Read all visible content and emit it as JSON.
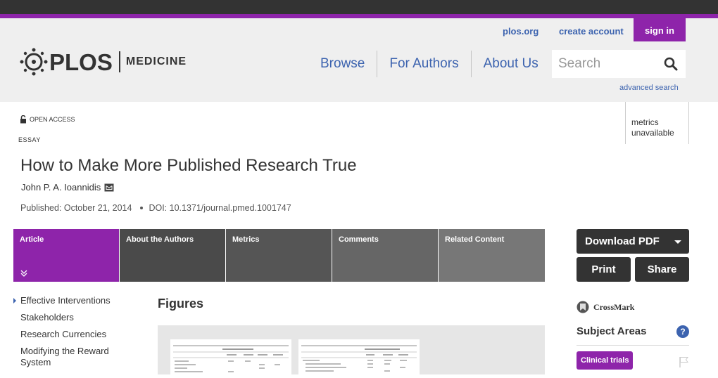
{
  "header": {
    "util_links": [
      "plos.org",
      "create account"
    ],
    "signin_label": "sign in",
    "logo_text": "PLOS",
    "journal_name": "MEDICINE",
    "nav": [
      "Browse",
      "For Authors",
      "About Us"
    ],
    "search_placeholder": "Search",
    "advanced_search": "advanced search"
  },
  "metrics": {
    "text_line1": "metrics",
    "text_line2": "unavailable"
  },
  "article": {
    "open_access": "OPEN ACCESS",
    "type": "ESSAY",
    "title": "How to Make More Published Research True",
    "author": "John P. A. Ioannidis",
    "published": "Published: October 21, 2014",
    "doi": "DOI: 10.1371/journal.pmed.1001747"
  },
  "tabs": [
    "Article",
    "About the Authors",
    "Metrics",
    "Comments",
    "Related Content"
  ],
  "toc": [
    "Effective Interventions",
    "Stakeholders",
    "Research Currencies",
    "Modifying the Reward System"
  ],
  "figures_heading": "Figures",
  "sidebar": {
    "download_label": "Download PDF",
    "print_label": "Print",
    "share_label": "Share",
    "crossmark_label": "CrossMark",
    "subject_areas_heading": "Subject Areas",
    "help_label": "?",
    "subject_tag": "Clinical trials"
  },
  "colors": {
    "accent": "#8e24aa",
    "link": "#3c63af",
    "dark": "#333333"
  }
}
